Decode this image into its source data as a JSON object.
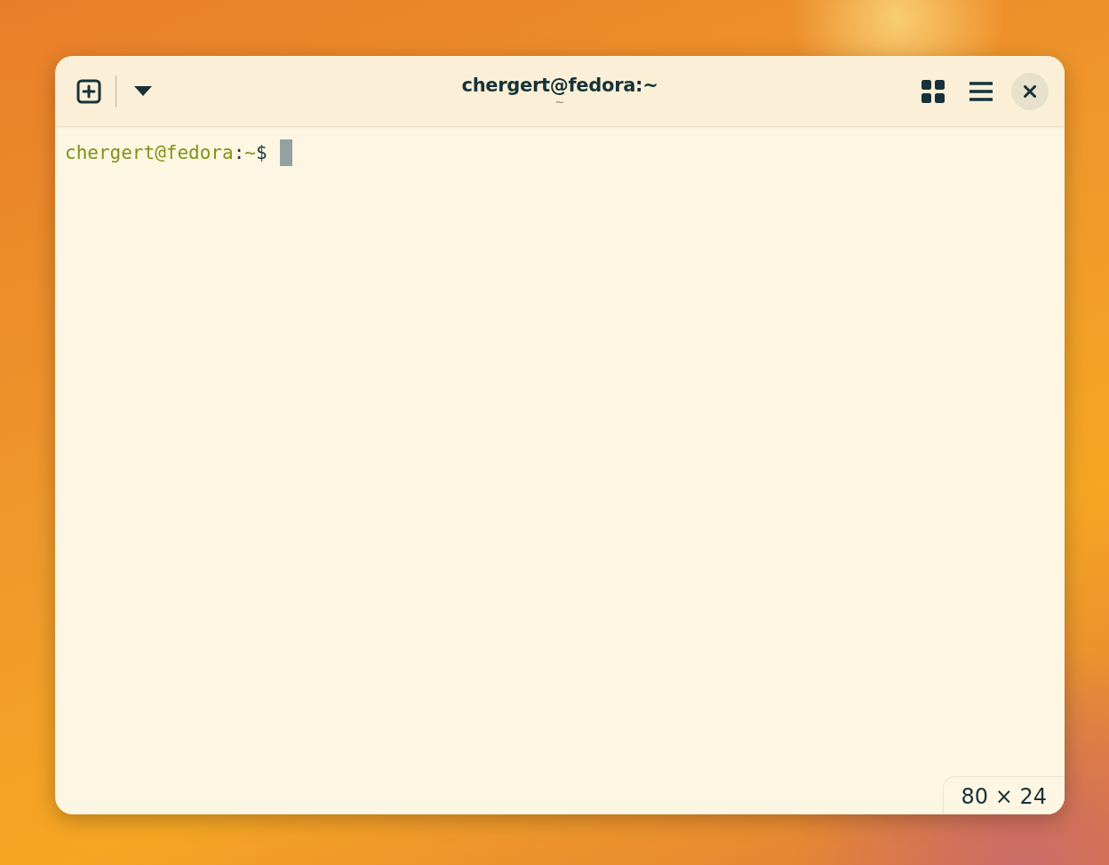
{
  "window": {
    "title": "chergert@fedora:~",
    "subtitle": "~"
  },
  "terminal": {
    "prompt": [
      {
        "text": "chergert@fedora",
        "kind": "host"
      },
      {
        "text": ":",
        "kind": "plain"
      },
      {
        "text": "~",
        "kind": "path"
      },
      {
        "text": "$",
        "kind": "plain"
      }
    ],
    "size": "80 × 24"
  }
}
